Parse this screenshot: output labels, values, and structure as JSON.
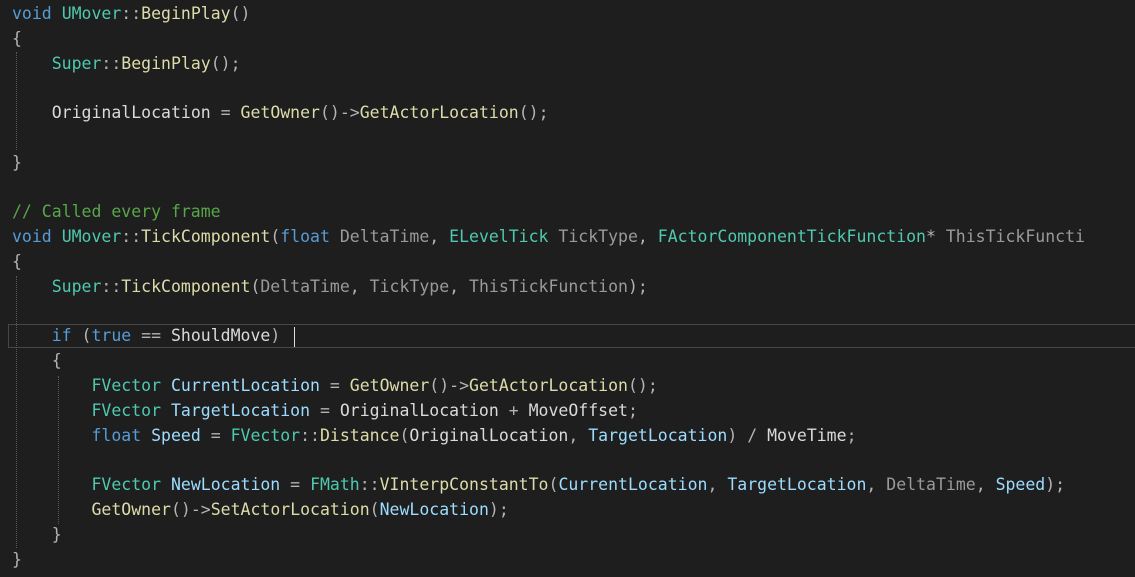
{
  "editor": {
    "lines": [
      [
        {
          "t": "void",
          "c": "kw"
        },
        {
          "t": " "
        },
        {
          "t": "UMover",
          "c": "type"
        },
        {
          "t": "::",
          "c": "punct"
        },
        {
          "t": "BeginPlay",
          "c": "fn"
        },
        {
          "t": "()",
          "c": "punct"
        }
      ],
      [
        {
          "t": "{",
          "c": "punct"
        }
      ],
      [
        {
          "t": "    "
        },
        {
          "t": "Super",
          "c": "type"
        },
        {
          "t": "::",
          "c": "punct"
        },
        {
          "t": "BeginPlay",
          "c": "fn"
        },
        {
          "t": "();",
          "c": "punct"
        }
      ],
      [],
      [
        {
          "t": "    "
        },
        {
          "t": "OriginalLocation",
          "c": "field"
        },
        {
          "t": " = ",
          "c": "punct"
        },
        {
          "t": "GetOwner",
          "c": "fn"
        },
        {
          "t": "()->",
          "c": "punct"
        },
        {
          "t": "GetActorLocation",
          "c": "fn"
        },
        {
          "t": "();",
          "c": "punct"
        }
      ],
      [],
      [
        {
          "t": "}",
          "c": "punct"
        }
      ],
      [],
      [
        {
          "t": "// Called every frame",
          "c": "comment"
        }
      ],
      [
        {
          "t": "void",
          "c": "kw"
        },
        {
          "t": " "
        },
        {
          "t": "UMover",
          "c": "type"
        },
        {
          "t": "::",
          "c": "punct"
        },
        {
          "t": "TickComponent",
          "c": "fn"
        },
        {
          "t": "(",
          "c": "punct"
        },
        {
          "t": "float",
          "c": "kw"
        },
        {
          "t": " "
        },
        {
          "t": "DeltaTime",
          "c": "param"
        },
        {
          "t": ", ",
          "c": "punct"
        },
        {
          "t": "ELevelTick",
          "c": "type"
        },
        {
          "t": " "
        },
        {
          "t": "TickType",
          "c": "param"
        },
        {
          "t": ", ",
          "c": "punct"
        },
        {
          "t": "FActorComponentTickFunction",
          "c": "type"
        },
        {
          "t": "* ",
          "c": "punct"
        },
        {
          "t": "ThisTickFuncti",
          "c": "param"
        }
      ],
      [
        {
          "t": "{",
          "c": "punct"
        }
      ],
      [
        {
          "t": "    "
        },
        {
          "t": "Super",
          "c": "type"
        },
        {
          "t": "::",
          "c": "punct"
        },
        {
          "t": "TickComponent",
          "c": "fn"
        },
        {
          "t": "(",
          "c": "punct"
        },
        {
          "t": "DeltaTime",
          "c": "param"
        },
        {
          "t": ", ",
          "c": "punct"
        },
        {
          "t": "TickType",
          "c": "param"
        },
        {
          "t": ", ",
          "c": "punct"
        },
        {
          "t": "ThisTickFunction",
          "c": "param"
        },
        {
          "t": ");",
          "c": "punct"
        }
      ],
      [],
      [
        {
          "t": "    "
        },
        {
          "t": "if",
          "c": "kw"
        },
        {
          "t": " (",
          "c": "punct"
        },
        {
          "t": "true",
          "c": "kw"
        },
        {
          "t": " == ",
          "c": "punct"
        },
        {
          "t": "ShouldMove",
          "c": "field"
        },
        {
          "t": ")",
          "c": "punct"
        }
      ],
      [
        {
          "t": "    "
        },
        {
          "t": "{",
          "c": "punct"
        }
      ],
      [
        {
          "t": "        "
        },
        {
          "t": "FVector",
          "c": "type"
        },
        {
          "t": " "
        },
        {
          "t": "CurrentLocation",
          "c": "var"
        },
        {
          "t": " = ",
          "c": "punct"
        },
        {
          "t": "GetOwner",
          "c": "fn"
        },
        {
          "t": "()->",
          "c": "punct"
        },
        {
          "t": "GetActorLocation",
          "c": "fn"
        },
        {
          "t": "();",
          "c": "punct"
        }
      ],
      [
        {
          "t": "        "
        },
        {
          "t": "FVector",
          "c": "type"
        },
        {
          "t": " "
        },
        {
          "t": "TargetLocation",
          "c": "var"
        },
        {
          "t": " = ",
          "c": "punct"
        },
        {
          "t": "OriginalLocation",
          "c": "field"
        },
        {
          "t": " + ",
          "c": "punct"
        },
        {
          "t": "MoveOffset",
          "c": "field"
        },
        {
          "t": ";",
          "c": "punct"
        }
      ],
      [
        {
          "t": "        "
        },
        {
          "t": "float",
          "c": "kw"
        },
        {
          "t": " "
        },
        {
          "t": "Speed",
          "c": "var"
        },
        {
          "t": " = ",
          "c": "punct"
        },
        {
          "t": "FVector",
          "c": "type"
        },
        {
          "t": "::",
          "c": "punct"
        },
        {
          "t": "Distance",
          "c": "fn"
        },
        {
          "t": "(",
          "c": "punct"
        },
        {
          "t": "OriginalLocation",
          "c": "field"
        },
        {
          "t": ", ",
          "c": "punct"
        },
        {
          "t": "TargetLocation",
          "c": "var"
        },
        {
          "t": ") / ",
          "c": "punct"
        },
        {
          "t": "MoveTime",
          "c": "field"
        },
        {
          "t": ";",
          "c": "punct"
        }
      ],
      [],
      [
        {
          "t": "        "
        },
        {
          "t": "FVector",
          "c": "type"
        },
        {
          "t": " "
        },
        {
          "t": "NewLocation",
          "c": "var"
        },
        {
          "t": " = ",
          "c": "punct"
        },
        {
          "t": "FMath",
          "c": "type"
        },
        {
          "t": "::",
          "c": "punct"
        },
        {
          "t": "VInterpConstantTo",
          "c": "fn"
        },
        {
          "t": "(",
          "c": "punct"
        },
        {
          "t": "CurrentLocation",
          "c": "var"
        },
        {
          "t": ", ",
          "c": "punct"
        },
        {
          "t": "TargetLocation",
          "c": "var"
        },
        {
          "t": ", ",
          "c": "punct"
        },
        {
          "t": "DeltaTime",
          "c": "param"
        },
        {
          "t": ", ",
          "c": "punct"
        },
        {
          "t": "Speed",
          "c": "var"
        },
        {
          "t": ");",
          "c": "punct"
        }
      ],
      [
        {
          "t": "        "
        },
        {
          "t": "GetOwner",
          "c": "fn"
        },
        {
          "t": "()->",
          "c": "punct"
        },
        {
          "t": "SetActorLocation",
          "c": "fn"
        },
        {
          "t": "(",
          "c": "punct"
        },
        {
          "t": "NewLocation",
          "c": "var"
        },
        {
          "t": ");",
          "c": "punct"
        }
      ],
      [
        {
          "t": "    "
        },
        {
          "t": "}",
          "c": "punct"
        }
      ],
      [
        {
          "t": "}",
          "c": "punct"
        }
      ]
    ]
  },
  "colors": {
    "background": "#1e1e1e",
    "keyword": "#569cd6",
    "type": "#4ec9b0",
    "function": "#dcdcaa",
    "local_variable": "#9cdcfe",
    "parameter": "#9a9a9a",
    "comment": "#57a64a",
    "member": "#dadada"
  }
}
